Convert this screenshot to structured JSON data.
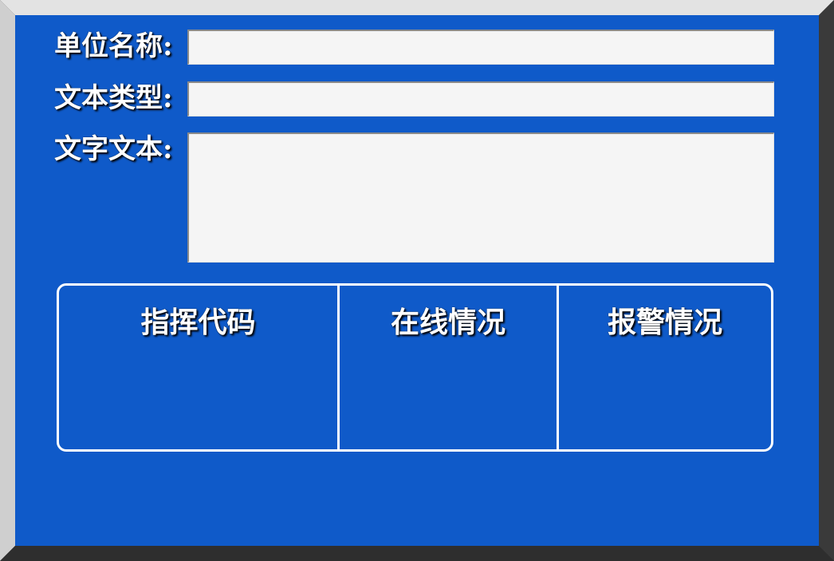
{
  "form": {
    "unit_name_label": "单位名称:",
    "unit_name_value": "",
    "text_type_label": "文本类型:",
    "text_type_value": "",
    "text_content_label": "文字文本:",
    "text_content_value": ""
  },
  "status": {
    "columns": [
      {
        "title": "指挥代码",
        "value": ""
      },
      {
        "title": "在线情况",
        "value": ""
      },
      {
        "title": "报警情况",
        "value": ""
      }
    ]
  },
  "colors": {
    "panel_background": "#0f5ac9",
    "field_background": "#f5f5f5",
    "text": "#ffffff"
  }
}
